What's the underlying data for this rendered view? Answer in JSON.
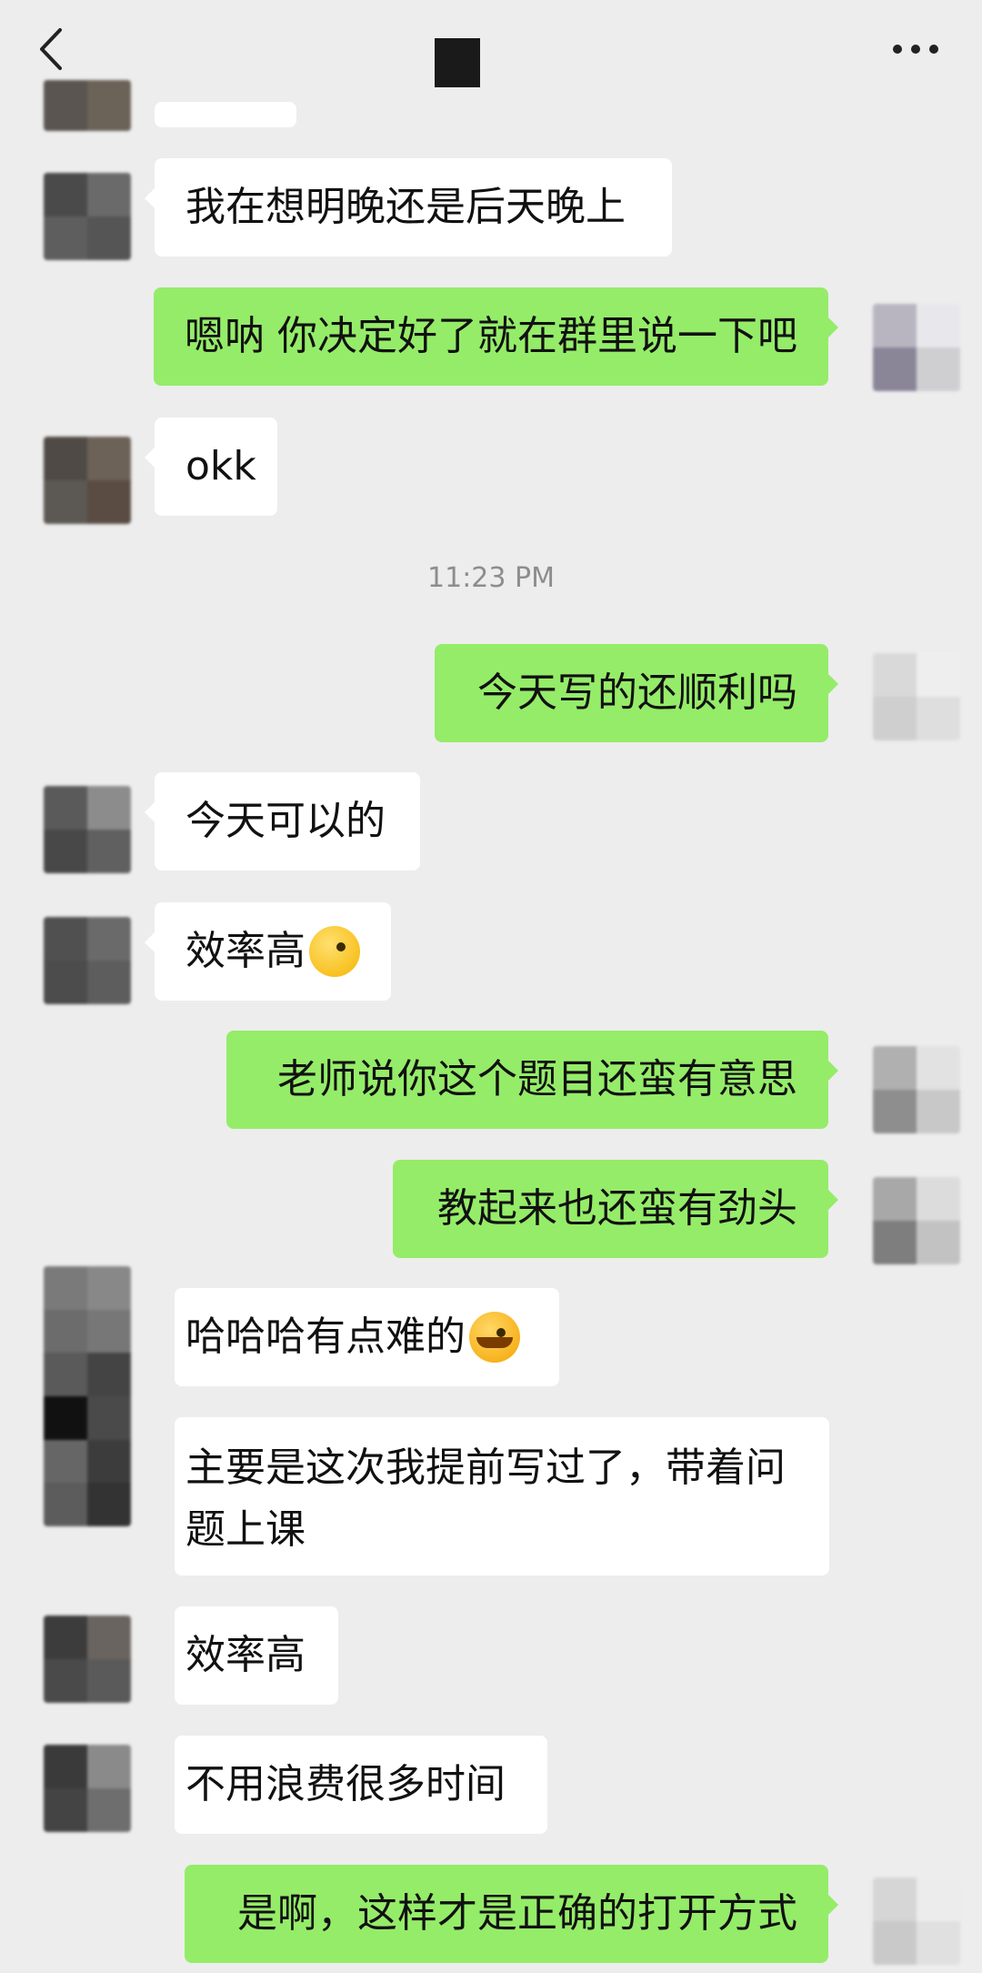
{
  "header": {
    "back_icon": "chevron-left-icon",
    "more_icon": "more-horizontal-icon"
  },
  "chat": {
    "timestamp": "11:23 PM",
    "messages": [
      {
        "side": "in",
        "text": "我在想明晚还是后天晚上"
      },
      {
        "side": "out",
        "text": "嗯呐 你决定好了就在群里说一下吧"
      },
      {
        "side": "in",
        "text": "okk"
      },
      {
        "side": "out",
        "text": "今天写的还顺利吗"
      },
      {
        "side": "in",
        "text": "今天可以的"
      },
      {
        "side": "in",
        "text": "效率高",
        "emoji": "face-peek-emoji"
      },
      {
        "side": "out",
        "text": "老师说你这个题目还蛮有意思"
      },
      {
        "side": "out",
        "text": "教起来也还蛮有劲头"
      },
      {
        "side": "in",
        "text": "哈哈哈有点难的",
        "emoji": "face-cry-laugh-emoji"
      },
      {
        "side": "in",
        "text": "主要是这次我提前写过了，带着问题上课"
      },
      {
        "side": "in",
        "text": "效率高"
      },
      {
        "side": "in",
        "text": "不用浪费很多时间"
      },
      {
        "side": "out",
        "text": "是啊，这样才是正确的打开方式"
      }
    ]
  },
  "colors": {
    "background": "#ededed",
    "bubble_in": "#ffffff",
    "bubble_out": "#95ec69"
  }
}
